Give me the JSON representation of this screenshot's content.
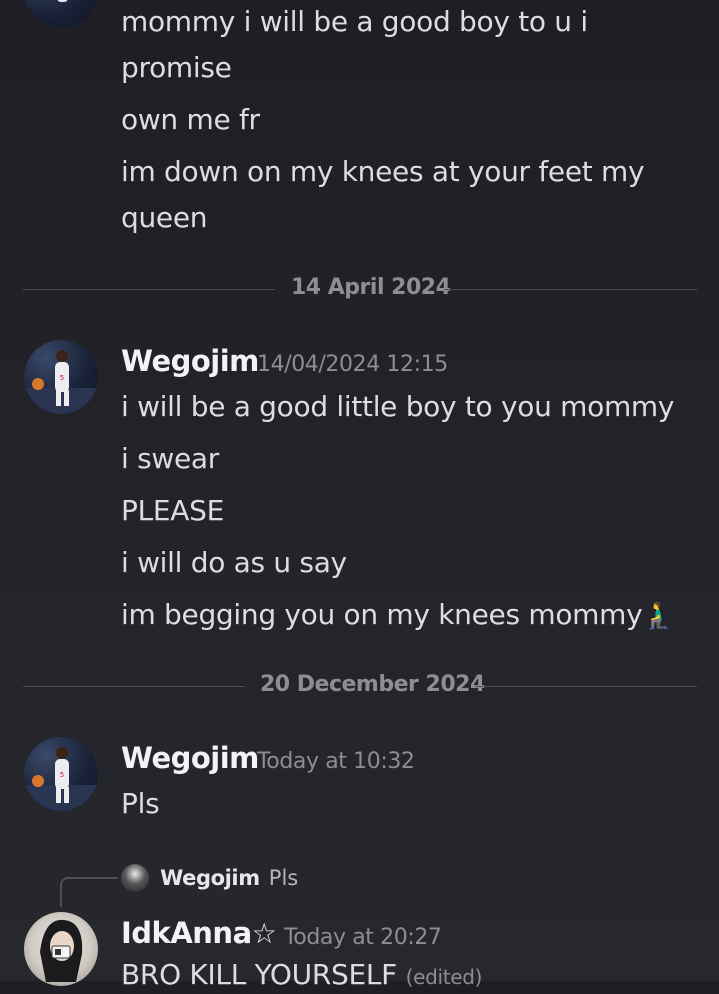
{
  "top_message": {
    "lines": [
      "mommy i will be a good boy to u i",
      "promise",
      "own me fr",
      "im down on my knees at your feet my",
      "queen"
    ]
  },
  "dividers": [
    "14 April 2024",
    "20 December 2024"
  ],
  "message_1": {
    "username": "Wegojim",
    "timestamp": "14/04/2024 12:15",
    "lines": [
      "i will be a good little boy to you mommy",
      "i swear",
      "PLEASE",
      "i will do as u say",
      "im begging you on my knees mommy"
    ],
    "emoji": "🧎‍♂️"
  },
  "message_2": {
    "username": "Wegojim",
    "timestamp": "Today at 10:32",
    "lines": [
      "Pls"
    ]
  },
  "reply": {
    "reply_to_username": "Wegojim",
    "reply_to_text": "Pls",
    "username": "IdkAnna",
    "username_star": "☆",
    "timestamp": "Today at 20:27",
    "text": "BRO KILL YOURSELF",
    "edited": "(edited)"
  },
  "colors": {
    "background": "#1e1e24",
    "text": "#dcdde2",
    "muted": "#8d8e95",
    "username": "#f2f3f5",
    "divider": "#4a4b53"
  }
}
